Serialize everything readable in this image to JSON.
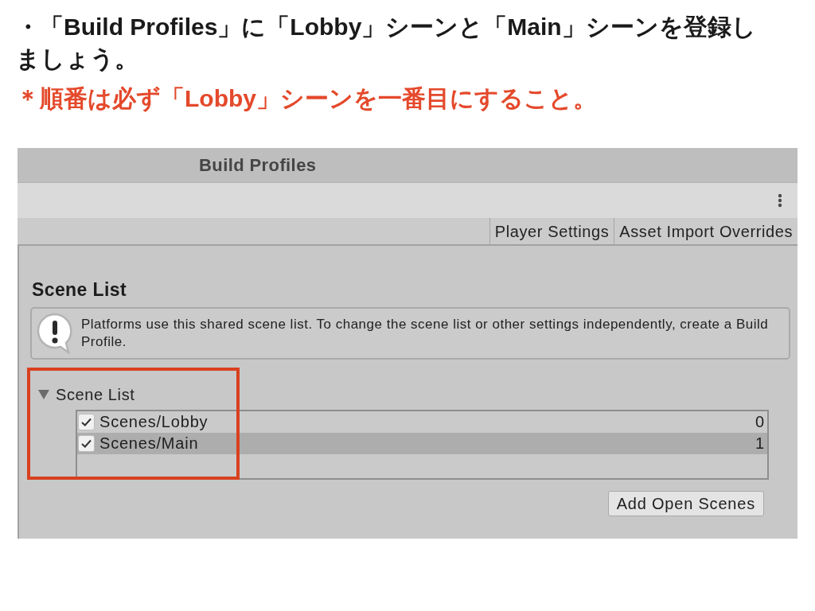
{
  "instructions": [
    {
      "kind": "step",
      "text": "・「Build Profiles」に「Lobby」シーンと「Main」シーンを登録しましょう。"
    },
    {
      "kind": "note",
      "text": "＊順番は必ず「Lobby」シーンを一番目にすること。"
    }
  ],
  "window": {
    "title": "Build Profiles",
    "toolbar_buttons": [
      {
        "label": "Player Settings"
      },
      {
        "label": "Asset Import Overrides"
      }
    ],
    "section_heading": "Scene List",
    "help_box": {
      "message": "Platforms use this shared scene list. To change the scene list or other settings independently, create a Build Profile."
    },
    "scene_list": {
      "label": "Scene List",
      "expanded": true,
      "scenes": [
        {
          "path": "Scenes/Lobby",
          "checked": true,
          "index": "0",
          "selected": false
        },
        {
          "path": "Scenes/Main",
          "checked": true,
          "index": "1",
          "selected": true
        }
      ]
    },
    "add_button": {
      "label": "Add Open Scenes"
    }
  }
}
